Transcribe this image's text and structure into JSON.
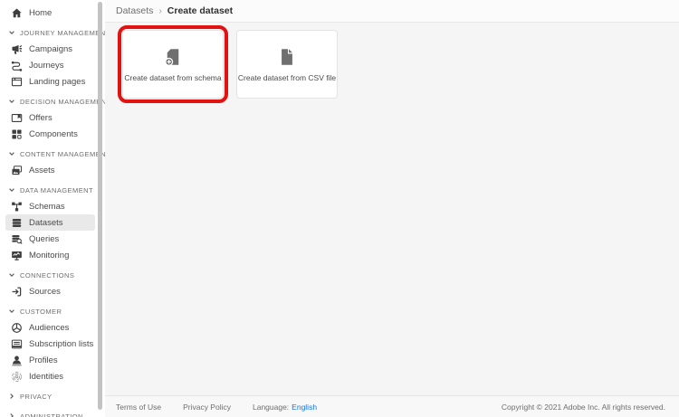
{
  "sidebar": {
    "items": [
      {
        "type": "link",
        "label": "Home",
        "icon": "home-icon"
      },
      {
        "type": "section",
        "label": "JOURNEY MANAGEMENT",
        "expanded": true
      },
      {
        "type": "link",
        "label": "Campaigns",
        "icon": "campaigns-icon"
      },
      {
        "type": "link",
        "label": "Journeys",
        "icon": "journeys-icon"
      },
      {
        "type": "link",
        "label": "Landing pages",
        "icon": "landing-pages-icon"
      },
      {
        "type": "section",
        "label": "DECISION MANAGEMENT",
        "expanded": true
      },
      {
        "type": "link",
        "label": "Offers",
        "icon": "offers-icon"
      },
      {
        "type": "link",
        "label": "Components",
        "icon": "components-icon"
      },
      {
        "type": "section",
        "label": "CONTENT MANAGEMENT",
        "expanded": true
      },
      {
        "type": "link",
        "label": "Assets",
        "icon": "assets-icon"
      },
      {
        "type": "section",
        "label": "DATA MANAGEMENT",
        "expanded": true
      },
      {
        "type": "link",
        "label": "Schemas",
        "icon": "schemas-icon"
      },
      {
        "type": "link",
        "label": "Datasets",
        "icon": "datasets-icon",
        "selected": true
      },
      {
        "type": "link",
        "label": "Queries",
        "icon": "queries-icon"
      },
      {
        "type": "link",
        "label": "Monitoring",
        "icon": "monitoring-icon"
      },
      {
        "type": "section",
        "label": "CONNECTIONS",
        "expanded": true
      },
      {
        "type": "link",
        "label": "Sources",
        "icon": "sources-icon"
      },
      {
        "type": "section",
        "label": "CUSTOMER",
        "expanded": true
      },
      {
        "type": "link",
        "label": "Audiences",
        "icon": "audiences-icon"
      },
      {
        "type": "link",
        "label": "Subscription lists",
        "icon": "subscription-lists-icon"
      },
      {
        "type": "link",
        "label": "Profiles",
        "icon": "profiles-icon"
      },
      {
        "type": "link",
        "label": "Identities",
        "icon": "identities-icon"
      },
      {
        "type": "section",
        "label": "PRIVACY",
        "expanded": false
      },
      {
        "type": "section",
        "label": "ADMINISTRATION",
        "expanded": false
      }
    ]
  },
  "breadcrumb": {
    "items": [
      {
        "label": "Datasets"
      },
      {
        "label": "Create dataset"
      }
    ],
    "separator": "›"
  },
  "main": {
    "cards": [
      {
        "label": "Create dataset from schema",
        "icon": "dataset-schema-icon",
        "highlighted": true
      },
      {
        "label": "Create dataset from CSV file",
        "icon": "csv-file-icon",
        "highlighted": false
      }
    ]
  },
  "footer": {
    "terms": "Terms of Use",
    "privacy": "Privacy Policy",
    "language_label": "Language:",
    "language_value": "English",
    "copyright": "Copyright  ©  2021 Adobe Inc.  All rights reserved."
  },
  "colors": {
    "annotation_red": "#e31111",
    "link_blue": "#1473e6",
    "selected_item_bg": "#e9e9e9"
  }
}
